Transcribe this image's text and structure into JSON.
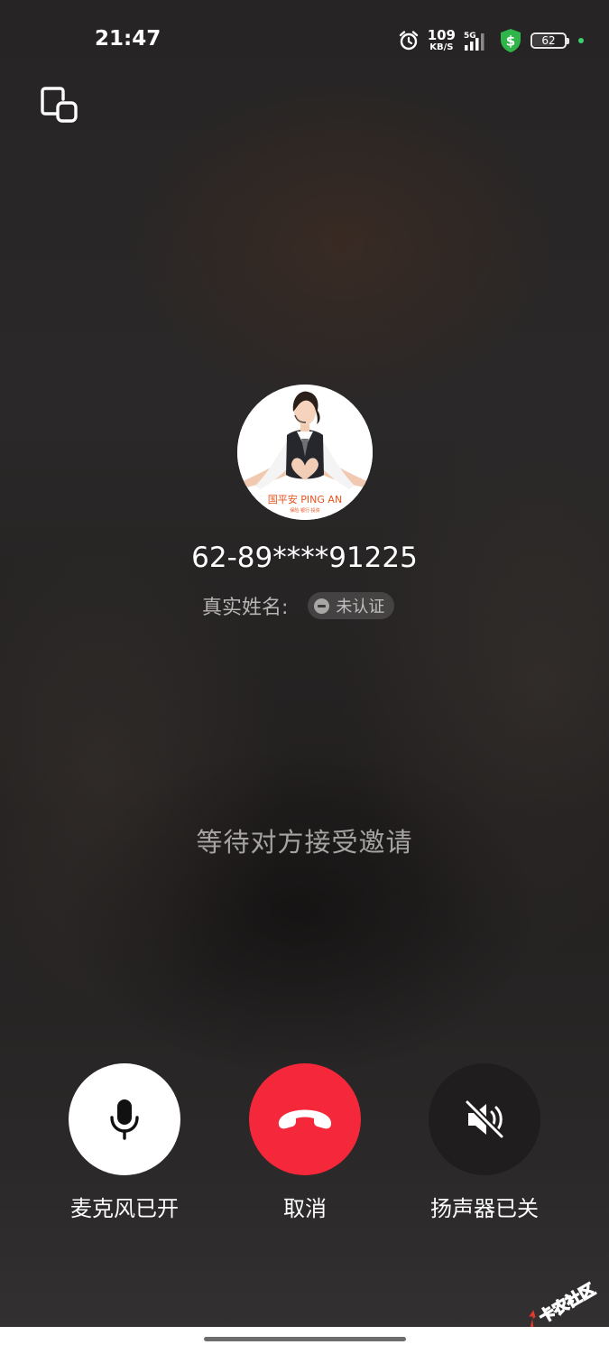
{
  "status_bar": {
    "time": "21:47",
    "net_speed_value": "109",
    "net_speed_unit": "KB/S",
    "network_type": "5G",
    "battery": "62",
    "icons": [
      "alarm-icon",
      "signal-icon",
      "shield-dollar-icon",
      "battery-icon"
    ]
  },
  "call": {
    "number": "62-89****91225",
    "real_name_label": "真实姓名:",
    "verify_status": "未认证",
    "waiting_text": "等待对方接受邀请",
    "avatar_logo_text": "国平安 PING AN",
    "avatar_slogan_text": "保险·银行·投资"
  },
  "controls": {
    "mic_label": "麦克风已开",
    "hangup_label": "取消",
    "speaker_label": "扬声器已关"
  },
  "colors": {
    "hangup": "#f4283a",
    "mic_button": "#ffffff",
    "speaker_button": "#1f1d1d",
    "shield": "#2fb54a"
  },
  "watermark_text": "卡农社区"
}
